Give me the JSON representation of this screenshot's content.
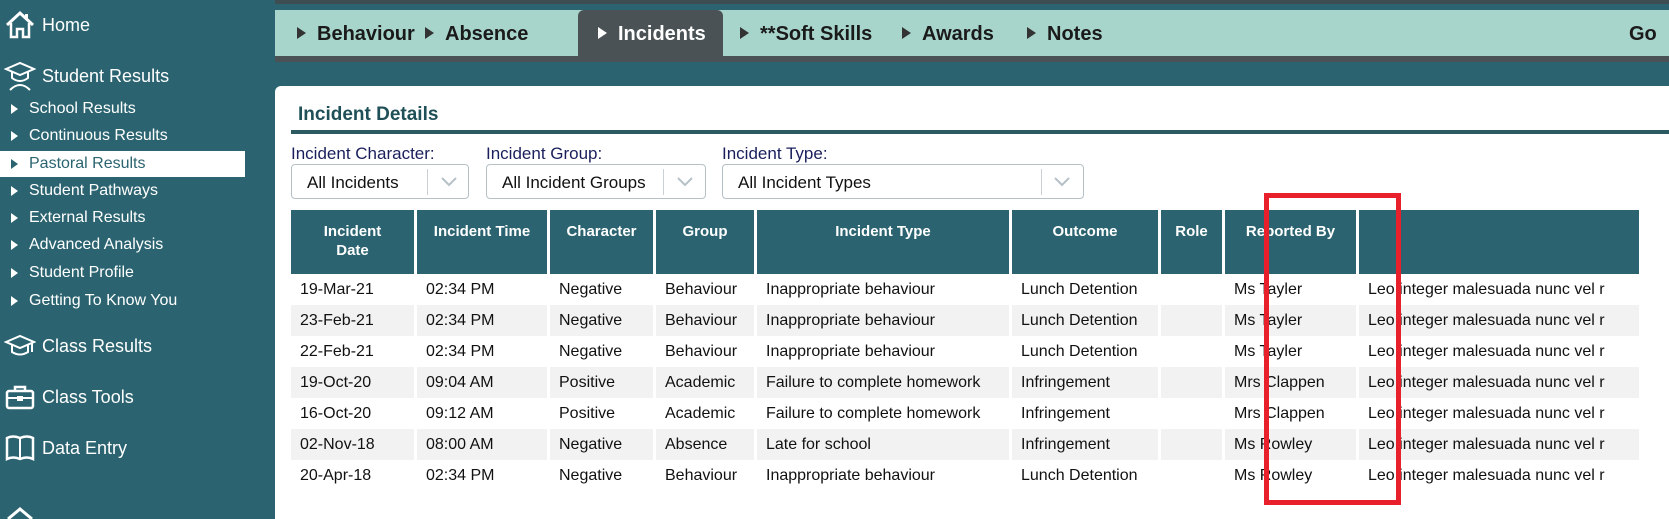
{
  "sidebar": {
    "main_items": [
      {
        "label": "Home",
        "icon": "home-icon"
      },
      {
        "label": "Student Results",
        "icon": "student-icon"
      },
      {
        "label": "Class Results",
        "icon": "graduation-cap-icon"
      },
      {
        "label": "Class Tools",
        "icon": "toolbox-icon"
      },
      {
        "label": "Data Entry",
        "icon": "book-icon"
      }
    ],
    "sub_items": [
      {
        "label": "School Results"
      },
      {
        "label": "Continuous Results"
      },
      {
        "label": "Pastoral Results"
      },
      {
        "label": "Student Pathways"
      },
      {
        "label": "External Results"
      },
      {
        "label": "Advanced Analysis"
      },
      {
        "label": "Student Profile"
      },
      {
        "label": "Getting To Know You"
      }
    ],
    "active_sub": "Pastoral Results"
  },
  "tabs": [
    {
      "label": "Behaviour"
    },
    {
      "label": "Absence"
    },
    {
      "label": "Incidents"
    },
    {
      "label": "**Soft Skills"
    },
    {
      "label": "Awards"
    },
    {
      "label": "Notes"
    }
  ],
  "active_tab": "Incidents",
  "go_label": "Go",
  "panel": {
    "title": "Incident Details",
    "filters": {
      "character": {
        "label": "Incident Character:",
        "value": "All Incidents"
      },
      "group": {
        "label": "Incident Group:",
        "value": "All Incident Groups"
      },
      "type": {
        "label": "Incident Type:",
        "value": "All Incident Types"
      }
    }
  },
  "table": {
    "headers": {
      "date_line1": "Incident",
      "date_line2": "Date",
      "time": "Incident Time",
      "character": "Character",
      "group": "Group",
      "type": "Incident Type",
      "outcome": "Outcome",
      "role": "Role",
      "reported_by": "Reported By",
      "details": ""
    },
    "rows": [
      {
        "date": "19-Mar-21",
        "time": "02:34 PM",
        "character": "Negative",
        "group": "Behaviour",
        "type": "Inappropriate behaviour",
        "outcome": "Lunch Detention",
        "role": "",
        "reported_by": "Ms Tayler",
        "details": "Leo integer malesuada nunc vel r"
      },
      {
        "date": "23-Feb-21",
        "time": "02:34 PM",
        "character": "Negative",
        "group": "Behaviour",
        "type": "Inappropriate behaviour",
        "outcome": "Lunch Detention",
        "role": "",
        "reported_by": "Ms Tayler",
        "details": "Leo integer malesuada nunc vel r"
      },
      {
        "date": "22-Feb-21",
        "time": "02:34 PM",
        "character": "Negative",
        "group": "Behaviour",
        "type": "Inappropriate behaviour",
        "outcome": "Lunch Detention",
        "role": "",
        "reported_by": "Ms Tayler",
        "details": "Leo integer malesuada nunc vel r"
      },
      {
        "date": "19-Oct-20",
        "time": "09:04 AM",
        "character": "Positive",
        "group": "Academic",
        "type": "Failure to complete homework",
        "outcome": "Infringement",
        "role": "",
        "reported_by": "Mrs Clappen",
        "details": "Leo integer malesuada nunc vel r"
      },
      {
        "date": "16-Oct-20",
        "time": "09:12 AM",
        "character": "Positive",
        "group": "Academic",
        "type": "Failure to complete homework",
        "outcome": "Infringement",
        "role": "",
        "reported_by": "Mrs Clappen",
        "details": "Leo integer malesuada nunc vel r"
      },
      {
        "date": "02-Nov-18",
        "time": "08:00 AM",
        "character": "Negative",
        "group": "Absence",
        "type": "Late for school",
        "outcome": "Infringement",
        "role": "",
        "reported_by": "Ms Rowley",
        "details": "Leo integer malesuada nunc vel r"
      },
      {
        "date": "20-Apr-18",
        "time": "02:34 PM",
        "character": "Negative",
        "group": "Behaviour",
        "type": "Inappropriate behaviour",
        "outcome": "Lunch Detention",
        "role": "",
        "reported_by": "Ms Rowley",
        "details": "Leo integer malesuada nunc vel r"
      }
    ]
  },
  "colors": {
    "brand_teal": "#2b6470",
    "tab_bar": "#a8d5cb",
    "active_tab": "#4a5255",
    "highlight": "#e8202b"
  }
}
